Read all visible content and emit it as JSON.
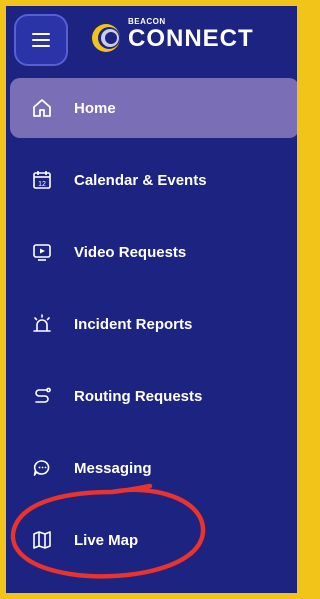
{
  "header": {
    "logo_small": "BEACON",
    "logo_big": "CONNECT"
  },
  "nav": {
    "items": [
      {
        "label": "Home",
        "icon": "home-icon",
        "active": true
      },
      {
        "label": "Calendar & Events",
        "icon": "calendar-icon",
        "active": false
      },
      {
        "label": "Video Requests",
        "icon": "video-icon",
        "active": false
      },
      {
        "label": "Incident Reports",
        "icon": "alarm-icon",
        "active": false
      },
      {
        "label": "Routing Requests",
        "icon": "route-icon",
        "active": false
      },
      {
        "label": "Messaging",
        "icon": "chat-icon",
        "active": false
      },
      {
        "label": "Live Map",
        "icon": "map-icon",
        "active": false
      }
    ]
  },
  "colors": {
    "frame": "#f2c318",
    "sidebar": "#1c2381",
    "active": "#7a6fb6",
    "annotation": "#e8332e"
  }
}
